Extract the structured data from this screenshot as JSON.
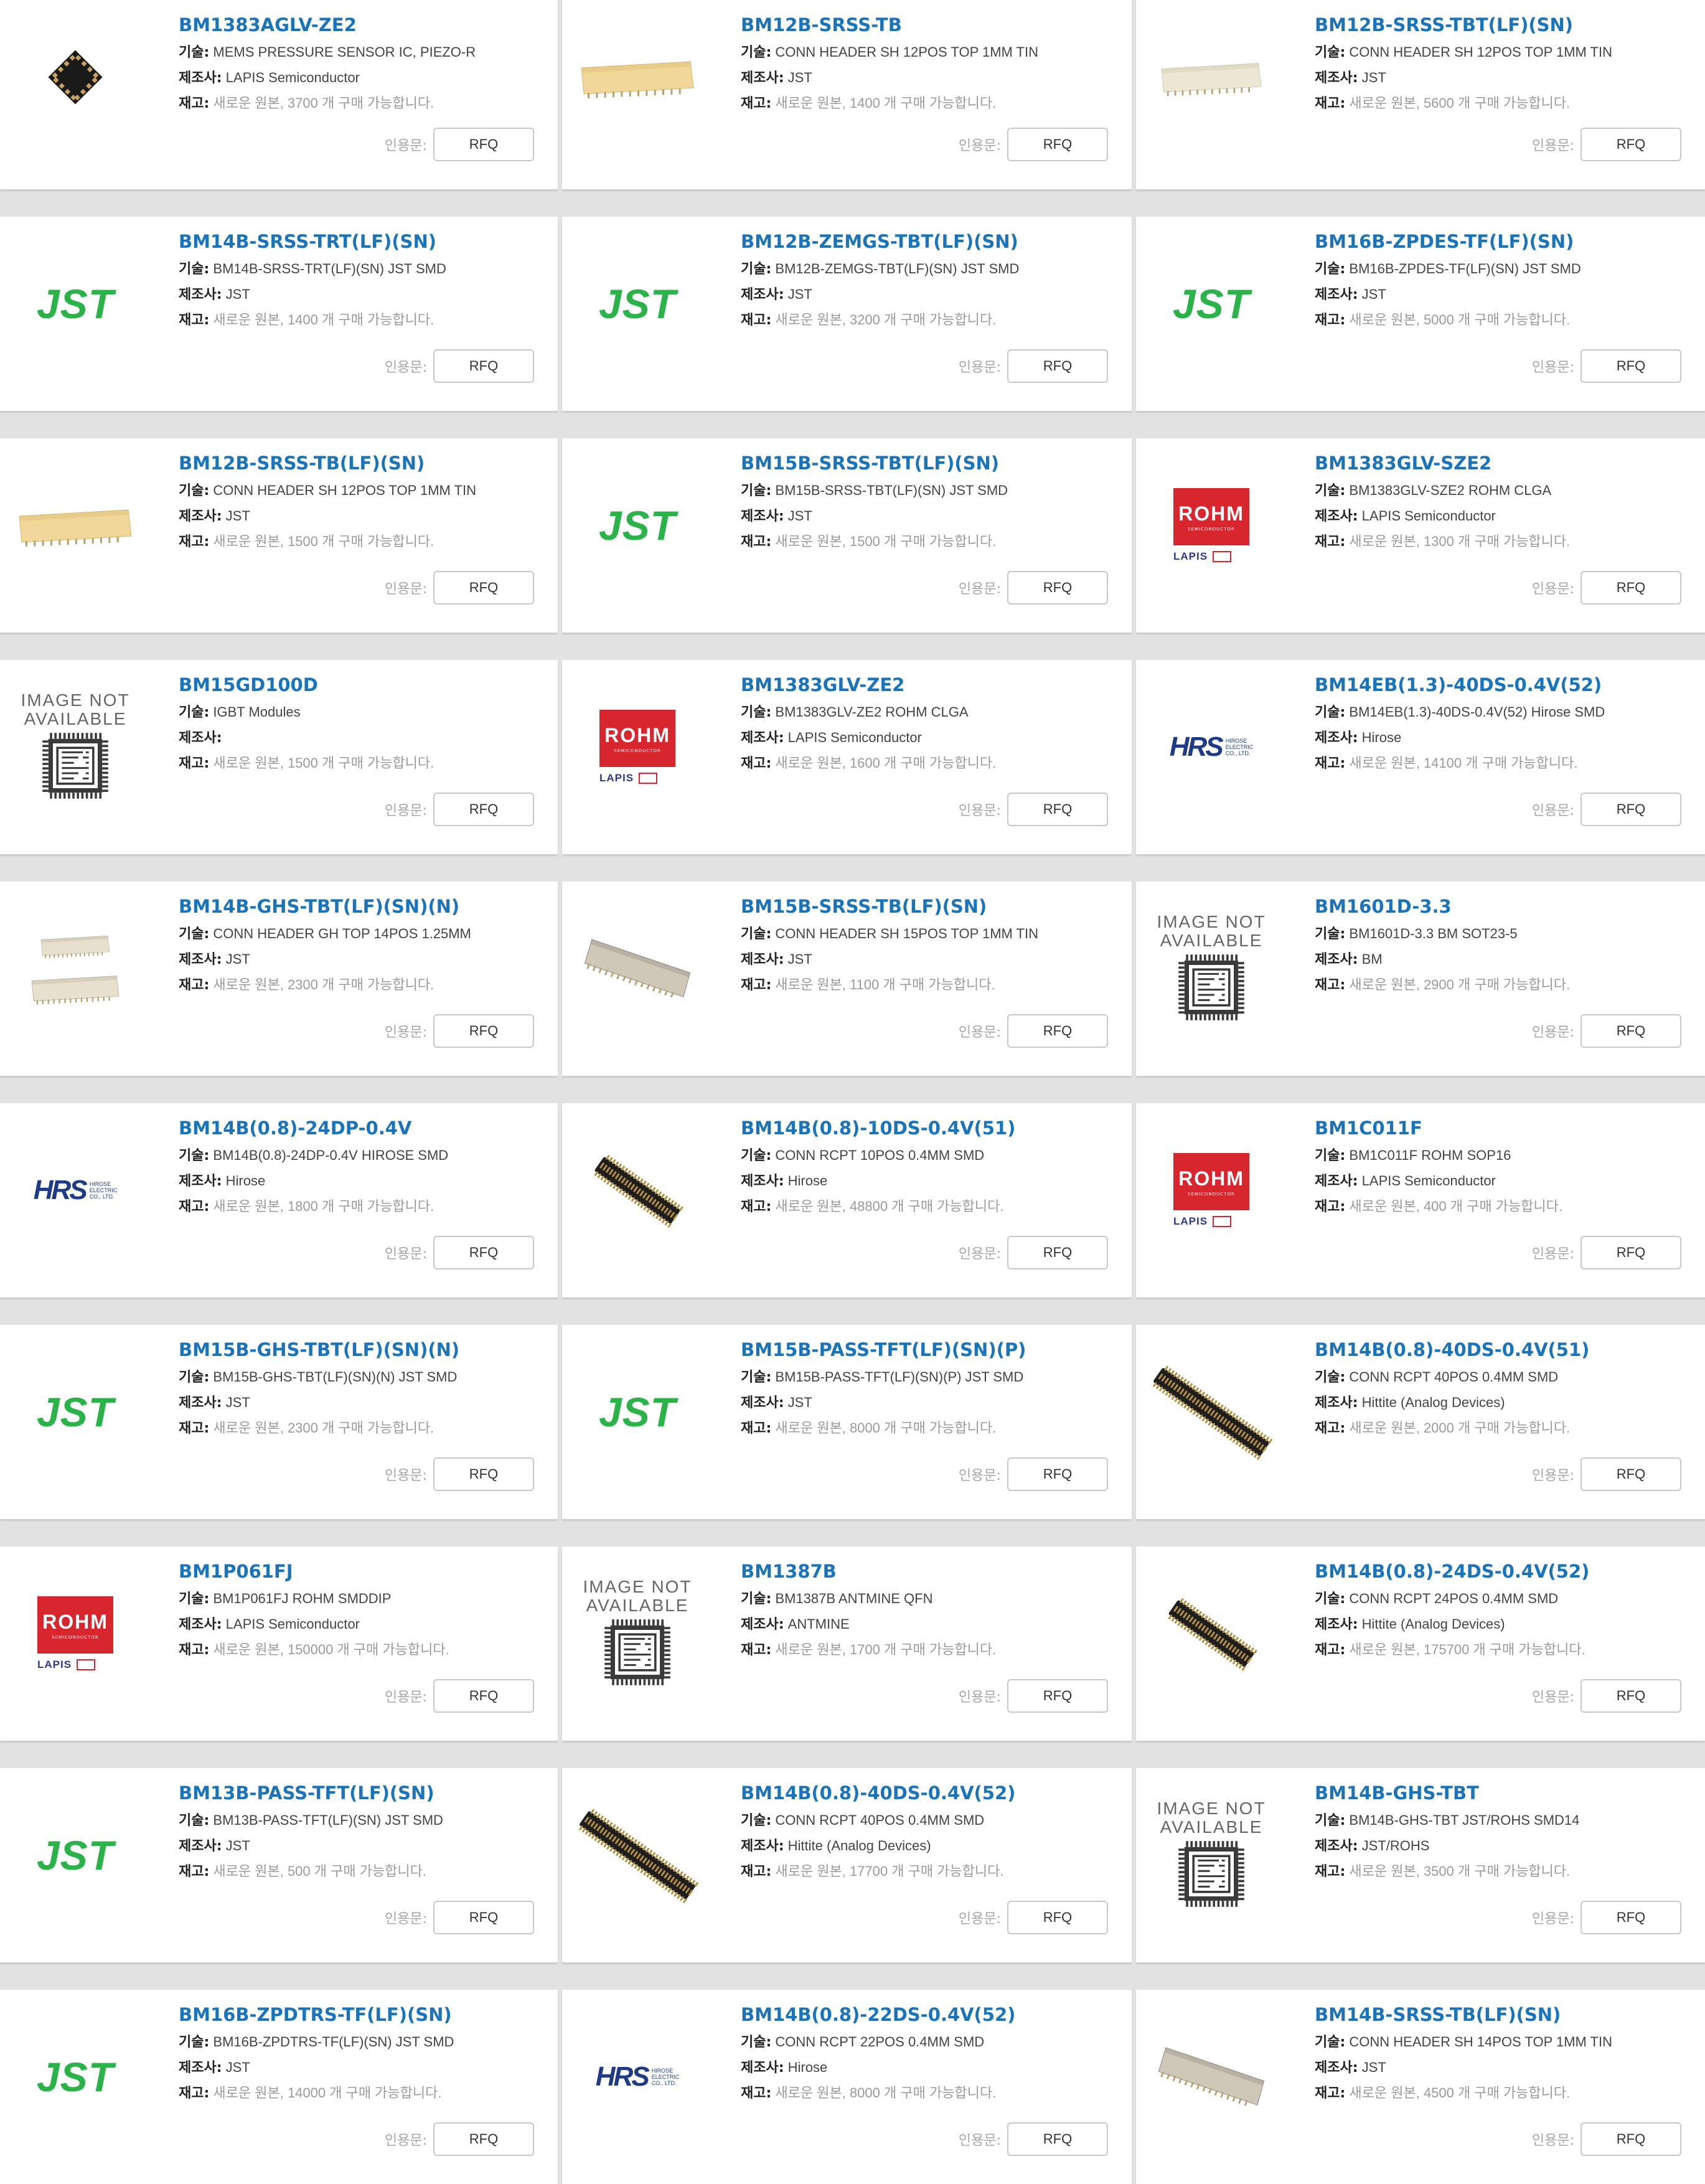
{
  "labels": {
    "desc": "기술:",
    "mfr": "제조사:",
    "stock": "재고:",
    "quote": "인용문:",
    "rfq": "RFQ",
    "ina_line1": "IMAGE NOT",
    "ina_line2": "AVAILABLE",
    "jst_logo": "JST",
    "rohm_logo": "ROHM",
    "rohm_sub": "SEMICONDUCTOR",
    "lapis_logo": "LAPIS",
    "hrs_logo": "HRS",
    "hrs_sub1": "HIROSE",
    "hrs_sub2": "ELECTRIC",
    "hrs_sub3": "CO., LTD."
  },
  "colors": {
    "part_link": "#1a74bc",
    "jst_green": "#2bb34a",
    "rohm_red": "#d8262f",
    "hirose_blue": "#1f3b85"
  },
  "products": [
    {
      "pn": "BM1383AGLV-ZE2",
      "desc": "MEMS PRESSURE SENSOR IC, PIEZO-R",
      "mfr": "LAPIS Semiconductor",
      "stock": "새로운 원본, 3700 개 구매 가능합니다.",
      "img": "chip-lga"
    },
    {
      "pn": "BM12B-SRSS-TB",
      "desc": "CONN HEADER SH 12POS TOP 1MM TIN",
      "mfr": "JST",
      "stock": "새로운 원본, 1400 개 구매 가능합니다.",
      "img": "header-yellow"
    },
    {
      "pn": "BM12B-SRSS-TBT(LF)(SN)",
      "desc": "CONN HEADER SH 12POS TOP 1MM TIN",
      "mfr": "JST",
      "stock": "새로운 원본, 5600 개 구매 가능합니다.",
      "img": "header-white"
    },
    {
      "pn": "BM14B-SRSS-TRT(LF)(SN)",
      "desc": "BM14B-SRSS-TRT(LF)(SN) JST SMD",
      "mfr": "JST",
      "stock": "새로운 원본, 1400 개 구매 가능합니다.",
      "img": "jst"
    },
    {
      "pn": "BM12B-ZEMGS-TBT(LF)(SN)",
      "desc": "BM12B-ZEMGS-TBT(LF)(SN) JST SMD",
      "mfr": "JST",
      "stock": "새로운 원본, 3200 개 구매 가능합니다.",
      "img": "jst"
    },
    {
      "pn": "BM16B-ZPDES-TF(LF)(SN)",
      "desc": "BM16B-ZPDES-TF(LF)(SN) JST SMD",
      "mfr": "JST",
      "stock": "새로운 원본, 5000 개 구매 가능합니다.",
      "img": "jst"
    },
    {
      "pn": "BM12B-SRSS-TB(LF)(SN)",
      "desc": "CONN HEADER SH 12POS TOP 1MM TIN",
      "mfr": "JST",
      "stock": "새로운 원본, 1500 개 구매 가능합니다.",
      "img": "header-yellow"
    },
    {
      "pn": "BM15B-SRSS-TBT(LF)(SN)",
      "desc": "BM15B-SRSS-TBT(LF)(SN) JST SMD",
      "mfr": "JST",
      "stock": "새로운 원본, 1500 개 구매 가능합니다.",
      "img": "jst"
    },
    {
      "pn": "BM1383GLV-SZE2",
      "desc": "BM1383GLV-SZE2 ROHM CLGA",
      "mfr": "LAPIS Semiconductor",
      "stock": "새로운 원본, 1300 개 구매 가능합니다.",
      "img": "rohm"
    },
    {
      "pn": "BM15GD100D",
      "desc": "IGBT Modules",
      "mfr": "",
      "stock": "새로운 원본, 1500 개 구매 가능합니다.",
      "img": "ina"
    },
    {
      "pn": "BM1383GLV-ZE2",
      "desc": "BM1383GLV-ZE2 ROHM CLGA",
      "mfr": "LAPIS Semiconductor",
      "stock": "새로운 원본, 1600 개 구매 가능합니다.",
      "img": "rohm"
    },
    {
      "pn": "BM14EB(1.3)-40DS-0.4V(52)",
      "desc": "BM14EB(1.3)-40DS-0.4V(52) Hirose SMD",
      "mfr": "Hirose",
      "stock": "새로운 원본, 14100 개 구매 가능합니다.",
      "img": "hrs"
    },
    {
      "pn": "BM14B-GHS-TBT(LF)(SN)(N)",
      "desc": "CONN HEADER GH TOP 14POS 1.25MM",
      "mfr": "JST",
      "stock": "새로운 원본, 2300 개 구매 가능합니다.",
      "img": "header-double"
    },
    {
      "pn": "BM15B-SRSS-TB(LF)(SN)",
      "desc": "CONN HEADER SH 15POS TOP 1MM TIN",
      "mfr": "JST",
      "stock": "새로운 원본, 1100 개 구매 가능합니다.",
      "img": "header-gray"
    },
    {
      "pn": "BM1601D-3.3",
      "desc": "BM1601D-3.3 BM SOT23-5",
      "mfr": "BM",
      "stock": "새로운 원본, 2900 개 구매 가능합니다.",
      "img": "ina"
    },
    {
      "pn": "BM14B(0.8)-24DP-0.4V",
      "desc": "BM14B(0.8)-24DP-0.4V HIROSE SMD",
      "mfr": "Hirose",
      "stock": "새로운 원본, 1800 개 구매 가능합니다.",
      "img": "hrs"
    },
    {
      "pn": "BM14B(0.8)-10DS-0.4V(51)",
      "desc": "CONN RCPT 10POS 0.4MM SMD",
      "mfr": "Hirose",
      "stock": "새로운 원본, 48800 개 구매 가능합니다.",
      "img": "rcpt-short"
    },
    {
      "pn": "BM1C011F",
      "desc": "BM1C011F ROHM SOP16",
      "mfr": "LAPIS Semiconductor",
      "stock": "새로운 원본, 400 개 구매 가능합니다.",
      "img": "rohm"
    },
    {
      "pn": "BM15B-GHS-TBT(LF)(SN)(N)",
      "desc": "BM15B-GHS-TBT(LF)(SN)(N) JST SMD",
      "mfr": "JST",
      "stock": "새로운 원본, 2300 개 구매 가능합니다.",
      "img": "jst"
    },
    {
      "pn": "BM15B-PASS-TFT(LF)(SN)(P)",
      "desc": "BM15B-PASS-TFT(LF)(SN)(P) JST SMD",
      "mfr": "JST",
      "stock": "새로운 원본, 8000 개 구매 가능합니다.",
      "img": "jst"
    },
    {
      "pn": "BM14B(0.8)-40DS-0.4V(51)",
      "desc": "CONN RCPT 40POS 0.4MM SMD",
      "mfr": "Hittite (Analog Devices)",
      "stock": "새로운 원본, 2000 개 구매 가능합니다.",
      "img": "rcpt-long"
    },
    {
      "pn": "BM1P061FJ",
      "desc": "BM1P061FJ ROHM SMDDIP",
      "mfr": "LAPIS Semiconductor",
      "stock": "새로운 원본, 150000 개 구매 가능합니다.",
      "img": "rohm"
    },
    {
      "pn": "BM1387B",
      "desc": "BM1387B ANTMINE QFN",
      "mfr": "ANTMINE",
      "stock": "새로운 원본, 1700 개 구매 가능합니다.",
      "img": "ina"
    },
    {
      "pn": "BM14B(0.8)-24DS-0.4V(52)",
      "desc": "CONN RCPT 24POS 0.4MM SMD",
      "mfr": "Hittite (Analog Devices)",
      "stock": "새로운 원본, 175700 개 구매 가능합니다.",
      "img": "rcpt-mid"
    },
    {
      "pn": "BM13B-PASS-TFT(LF)(SN)",
      "desc": "BM13B-PASS-TFT(LF)(SN) JST SMD",
      "mfr": "JST",
      "stock": "새로운 원본, 500 개 구매 가능합니다.",
      "img": "jst"
    },
    {
      "pn": "BM14B(0.8)-40DS-0.4V(52)",
      "desc": "CONN RCPT 40POS 0.4MM SMD",
      "mfr": "Hittite (Analog Devices)",
      "stock": "새로운 원본, 17700 개 구매 가능합니다.",
      "img": "rcpt-long"
    },
    {
      "pn": "BM14B-GHS-TBT",
      "desc": "BM14B-GHS-TBT JST/ROHS SMD14",
      "mfr": "JST/ROHS",
      "stock": "새로운 원본, 3500 개 구매 가능합니다.",
      "img": "ina"
    },
    {
      "pn": "BM16B-ZPDTRS-TF(LF)(SN)",
      "desc": "BM16B-ZPDTRS-TF(LF)(SN) JST SMD",
      "mfr": "JST",
      "stock": "새로운 원본, 14000 개 구매 가능합니다.",
      "img": "jst"
    },
    {
      "pn": "BM14B(0.8)-22DS-0.4V(52)",
      "desc": "CONN RCPT 22POS 0.4MM SMD",
      "mfr": "Hirose",
      "stock": "새로운 원본, 8000 개 구매 가능합니다.",
      "img": "hrs"
    },
    {
      "pn": "BM14B-SRSS-TB(LF)(SN)",
      "desc": "CONN HEADER SH 14POS TOP 1MM TIN",
      "mfr": "JST",
      "stock": "새로운 원본, 4500 개 구매 가능합니다.",
      "img": "header-gray"
    }
  ]
}
